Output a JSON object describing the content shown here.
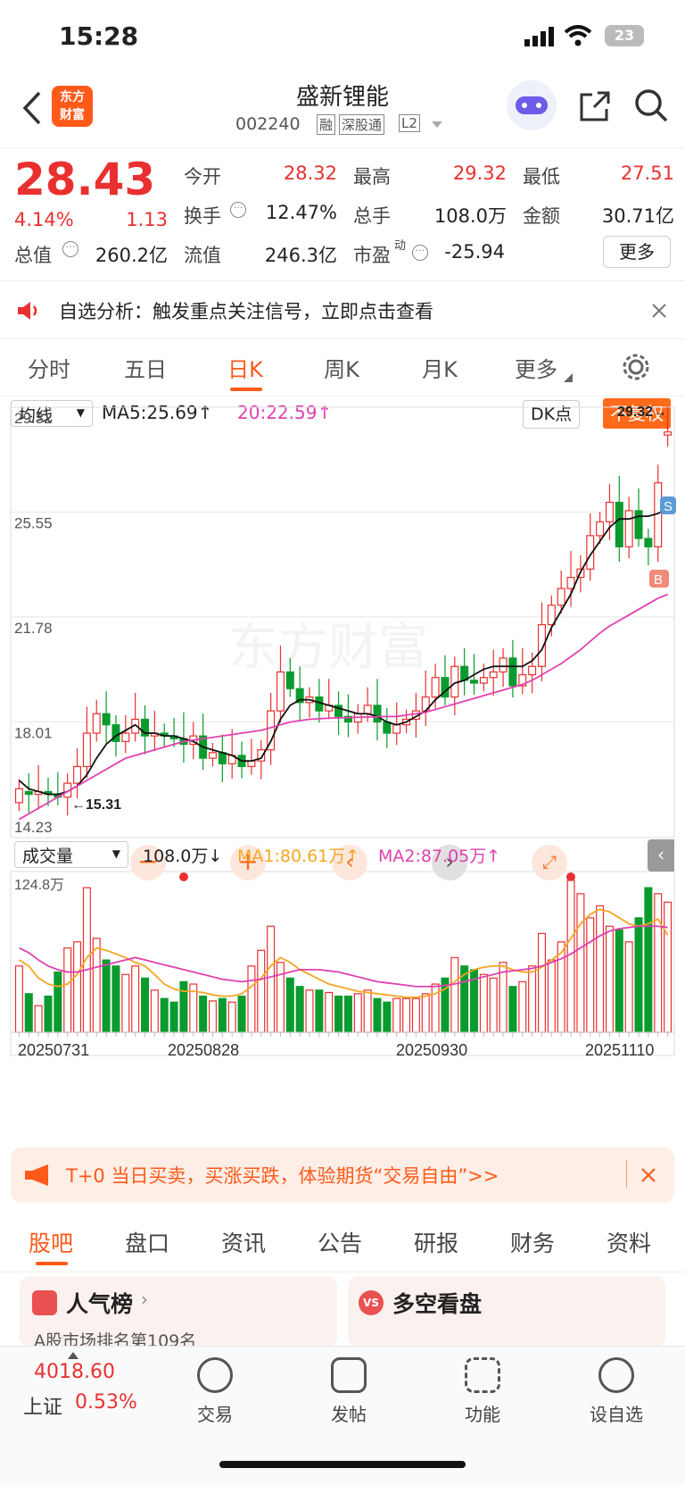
{
  "status": {
    "time": "15:28",
    "battery": "23"
  },
  "header": {
    "logo_line1": "东方",
    "logo_line2": "财富",
    "title": "盛新锂能",
    "code": "002240",
    "tags": [
      "融",
      "深股通",
      "L2"
    ]
  },
  "quote": {
    "price": "28.43",
    "pct": "4.14%",
    "chg": "1.13",
    "open_k": "今开",
    "open_v": "28.32",
    "high_k": "最高",
    "high_v": "29.32",
    "low_k": "最低",
    "low_v": "27.51",
    "turn_k": "换手",
    "turn_v": "12.47%",
    "vol_k": "总手",
    "vol_v": "108.0万",
    "amt_k": "金额",
    "amt_v": "30.71亿",
    "mcap_k": "总值",
    "mcap_v": "260.2亿",
    "float_k": "流值",
    "float_v": "246.3亿",
    "pe_k": "市盈",
    "pe_sup": "动",
    "pe_v": "-25.94",
    "more": "更多"
  },
  "notice": {
    "text": "自选分析：触发重点关注信号，立即点击查看"
  },
  "tabs": [
    "分时",
    "五日",
    "日K",
    "周K",
    "月K",
    "更多"
  ],
  "indicator": {
    "select": "均线",
    "ma5": "MA5:25.69↑",
    "ma20": "20:22.59↑",
    "dk": "DK点",
    "fq": "不复权"
  },
  "chart_data": {
    "type": "candlestick",
    "y_ticks": [
      "29.32",
      "25.55",
      "21.78",
      "18.01",
      "14.23"
    ],
    "high_label": "29.32→",
    "low_label": "←15.31",
    "x_labels": [
      "20250731",
      "20250828",
      "20250930",
      "20251110"
    ],
    "markers": {
      "buy": "B",
      "sell": "S"
    },
    "watermark": "东方财富",
    "close": [
      15.6,
      15.4,
      15.5,
      15.4,
      15.3,
      15.8,
      16.4,
      17.6,
      18.3,
      17.9,
      17.3,
      17.6,
      18.1,
      17.5,
      17.6,
      17.5,
      17.4,
      17.2,
      17.5,
      16.7,
      16.9,
      16.5,
      16.8,
      16.4,
      16.6,
      17.0,
      18.4,
      19.8,
      19.2,
      18.7,
      18.9,
      18.4,
      18.6,
      18.2,
      18.0,
      18.3,
      18.6,
      18.0,
      17.6,
      17.9,
      18.1,
      18.4,
      18.9,
      19.6,
      18.9,
      20.0,
      19.5,
      19.4,
      19.6,
      19.8,
      20.3,
      19.3,
      19.7,
      20.0,
      21.5,
      22.2,
      22.8,
      23.2,
      23.5,
      24.7,
      25.2,
      25.9,
      24.3,
      25.6,
      24.6,
      24.3,
      26.6,
      28.43
    ],
    "open": [
      15.1,
      15.5,
      15.4,
      15.5,
      15.4,
      15.3,
      15.8,
      16.4,
      17.6,
      18.3,
      17.9,
      17.3,
      17.6,
      18.1,
      17.5,
      17.6,
      17.5,
      17.4,
      17.2,
      17.5,
      16.7,
      16.9,
      16.5,
      16.8,
      16.4,
      16.6,
      17.0,
      18.4,
      19.8,
      19.2,
      18.7,
      18.9,
      18.4,
      18.6,
      18.2,
      18.0,
      18.3,
      18.6,
      18.0,
      17.6,
      17.9,
      18.1,
      18.4,
      18.9,
      19.6,
      18.9,
      20.0,
      19.5,
      19.4,
      19.6,
      19.8,
      20.3,
      19.3,
      19.7,
      20.0,
      21.5,
      22.2,
      22.8,
      23.2,
      23.5,
      24.7,
      25.2,
      25.9,
      24.3,
      25.6,
      24.6,
      24.3,
      28.32
    ],
    "ma5": [
      15.9,
      15.6,
      15.5,
      15.4,
      15.4,
      15.5,
      15.7,
      16.1,
      16.7,
      17.2,
      17.5,
      17.7,
      17.9,
      17.6,
      17.6,
      17.5,
      17.5,
      17.4,
      17.3,
      17.1,
      17.0,
      16.9,
      16.8,
      16.6,
      16.6,
      16.7,
      17.3,
      18.1,
      18.6,
      18.8,
      18.8,
      18.7,
      18.6,
      18.5,
      18.4,
      18.3,
      18.3,
      18.2,
      18.0,
      17.9,
      18.0,
      18.2,
      18.4,
      18.8,
      19.1,
      19.4,
      19.5,
      19.7,
      19.9,
      20.0,
      20.0,
      20.0,
      20.0,
      20.2,
      20.6,
      21.4,
      22.0,
      22.6,
      23.4,
      24.0,
      24.5,
      25.0,
      25.3,
      25.3,
      25.4,
      25.4,
      25.5,
      25.69
    ],
    "ma20": [
      14.5,
      14.7,
      14.9,
      15.1,
      15.3,
      15.5,
      15.7,
      15.9,
      16.1,
      16.3,
      16.5,
      16.7,
      16.8,
      16.9,
      17.0,
      17.1,
      17.2,
      17.3,
      17.35,
      17.4,
      17.45,
      17.5,
      17.55,
      17.6,
      17.65,
      17.7,
      17.8,
      17.9,
      18.0,
      18.05,
      18.1,
      18.12,
      18.14,
      18.15,
      18.16,
      18.17,
      18.18,
      18.19,
      18.2,
      18.2,
      18.25,
      18.3,
      18.35,
      18.45,
      18.55,
      18.65,
      18.75,
      18.85,
      18.95,
      19.05,
      19.15,
      19.25,
      19.35,
      19.5,
      19.7,
      19.9,
      20.1,
      20.35,
      20.6,
      20.9,
      21.2,
      21.45,
      21.65,
      21.85,
      22.05,
      22.25,
      22.45,
      22.59
    ],
    "volume_label": "成交量",
    "volume_value": "108.0万↓",
    "vol_ma1": "MA1:80.61万↑",
    "vol_ma2": "MA2:87.05万↑",
    "vol_max": "124.8万",
    "volume": [
      55,
      32,
      22,
      30,
      50,
      70,
      75,
      120,
      78,
      60,
      55,
      48,
      55,
      45,
      35,
      28,
      25,
      42,
      40,
      30,
      26,
      28,
      25,
      30,
      55,
      68,
      88,
      58,
      45,
      38,
      35,
      35,
      33,
      30,
      30,
      32,
      35,
      28,
      25,
      28,
      28,
      28,
      32,
      40,
      45,
      62,
      55,
      52,
      48,
      45,
      58,
      38,
      42,
      55,
      82,
      60,
      75,
      126,
      115,
      95,
      105,
      88,
      85,
      75,
      95,
      120,
      115,
      108
    ],
    "vol_ma1_vals": [
      60,
      55,
      45,
      40,
      38,
      40,
      48,
      62,
      70,
      68,
      65,
      62,
      58,
      55,
      48,
      40,
      36,
      34,
      34,
      33,
      31,
      30,
      30,
      32,
      38,
      45,
      55,
      62,
      58,
      52,
      48,
      44,
      40,
      38,
      36,
      34,
      33,
      32,
      31,
      30,
      29,
      29,
      30,
      32,
      36,
      42,
      48,
      52,
      54,
      55,
      55,
      52,
      50,
      50,
      54,
      60,
      66,
      78,
      90,
      98,
      102,
      100,
      95,
      90,
      88,
      90,
      94,
      80.61
    ],
    "vol_ma2_vals": [
      70,
      66,
      60,
      55,
      52,
      50,
      50,
      52,
      54,
      56,
      58,
      60,
      62,
      60,
      58,
      56,
      54,
      52,
      50,
      48,
      46,
      44,
      43,
      42,
      43,
      44,
      46,
      48,
      50,
      52,
      52,
      52,
      51,
      50,
      48,
      46,
      44,
      42,
      41,
      40,
      39,
      38,
      38,
      38,
      39,
      40,
      42,
      44,
      46,
      48,
      50,
      51,
      52,
      53,
      55,
      58,
      61,
      65,
      70,
      75,
      80,
      84,
      86,
      87,
      88,
      88,
      88,
      87.05
    ]
  },
  "ad": {
    "text": "T+0 当日买卖，买涨买跌，体验期货“交易自由”>>"
  },
  "subtabs": [
    "股吧",
    "盘口",
    "资讯",
    "公告",
    "研报",
    "财务",
    "资料"
  ],
  "cards": {
    "left_title": "人气榜",
    "left_sub": "A股市场排名第109名",
    "right_title": "多空看盘"
  },
  "bottom": {
    "index_value": "4018.60",
    "index_name": "上证",
    "index_pct": "0.53%",
    "items": [
      "交易",
      "发帖",
      "功能",
      "设自选"
    ]
  },
  "colors": {
    "up": "#e93030",
    "down": "#0a9b2e",
    "ma5": "#111111",
    "ma20": "#e040b0",
    "accent": "#ff6a1a"
  }
}
